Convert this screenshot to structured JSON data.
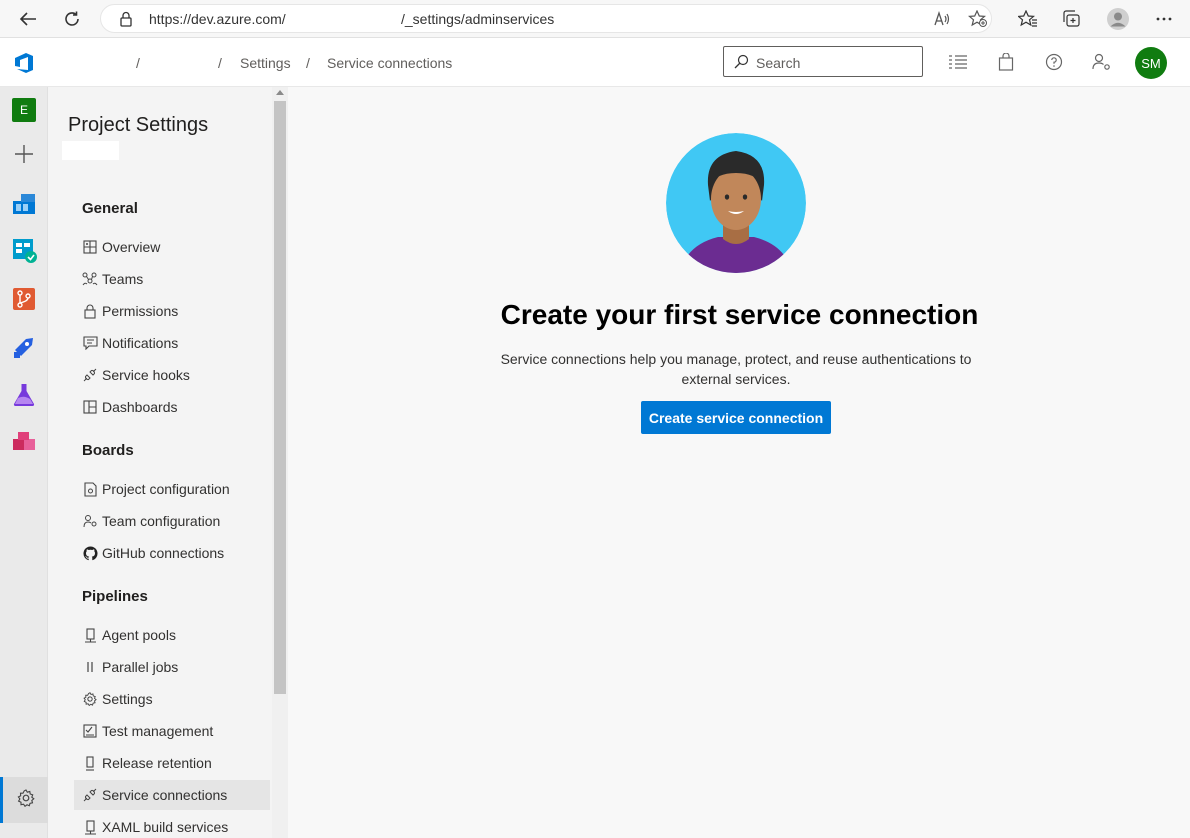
{
  "browser": {
    "url_left": "https://dev.azure.com/",
    "url_right": "/_settings/adminservices"
  },
  "header": {
    "breadcrumb": [
      "/",
      "/",
      "Settings",
      "/",
      "Service connections"
    ],
    "search_placeholder": "Search",
    "avatar_initials": "SM"
  },
  "rail": {
    "org_initial": "E"
  },
  "settings_nav": {
    "title": "Project Settings",
    "sections": [
      {
        "heading": "General",
        "items": [
          {
            "label": "Overview",
            "icon": "overview-icon"
          },
          {
            "label": "Teams",
            "icon": "teams-icon"
          },
          {
            "label": "Permissions",
            "icon": "lock-icon"
          },
          {
            "label": "Notifications",
            "icon": "notification-icon"
          },
          {
            "label": "Service hooks",
            "icon": "plug-icon"
          },
          {
            "label": "Dashboards",
            "icon": "dashboard-icon"
          }
        ]
      },
      {
        "heading": "Boards",
        "items": [
          {
            "label": "Project configuration",
            "icon": "project-config-icon"
          },
          {
            "label": "Team configuration",
            "icon": "team-config-icon"
          },
          {
            "label": "GitHub connections",
            "icon": "github-icon"
          }
        ]
      },
      {
        "heading": "Pipelines",
        "items": [
          {
            "label": "Agent pools",
            "icon": "agent-pool-icon"
          },
          {
            "label": "Parallel jobs",
            "icon": "parallel-icon"
          },
          {
            "label": "Settings",
            "icon": "gear-icon"
          },
          {
            "label": "Test management",
            "icon": "test-icon"
          },
          {
            "label": "Release retention",
            "icon": "retention-icon"
          },
          {
            "label": "Service connections",
            "icon": "plug-icon",
            "selected": true
          },
          {
            "label": "XAML build services",
            "icon": "agent-pool-icon"
          }
        ]
      }
    ]
  },
  "main": {
    "title": "Create your first service connection",
    "description": "Service connections help you manage, protect, and reuse authentications to external services.",
    "cta_label": "Create service connection"
  },
  "colors": {
    "accent": "#0078d4",
    "avatar_bg": "#107c10",
    "hero_bg": "#40c8f4"
  }
}
